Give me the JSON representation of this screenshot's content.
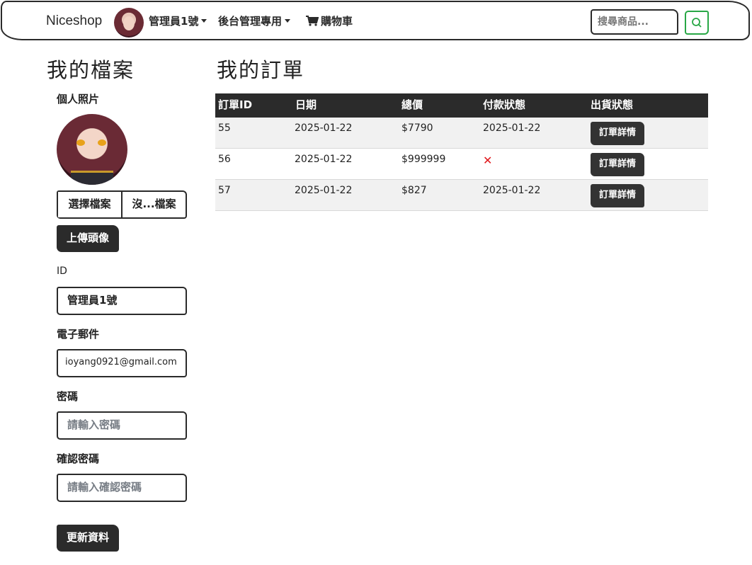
{
  "navbar": {
    "brand": "Niceshop",
    "user_menu": "管理員1號",
    "admin_menu": "後台管理專用",
    "cart": "購物車",
    "search_placeholder": "搜尋商品..."
  },
  "profile": {
    "title": "我的檔案",
    "photo_label": "個人照片",
    "choose_file": "選擇檔案",
    "file_name": "沒...檔案",
    "upload_button": "上傳頭像",
    "id_label": "ID",
    "id_value": "管理員1號",
    "email_label": "電子郵件",
    "email_value": "ioyang0921@gmail.com",
    "password_label": "密碼",
    "password_placeholder": "請輸入密碼",
    "confirm_label": "確認密碼",
    "confirm_placeholder": "請輸入確認密碼",
    "update_button": "更新資料"
  },
  "orders": {
    "title": "我的訂單",
    "headers": [
      "訂單ID",
      "日期",
      "總價",
      "付款狀態",
      "出貨狀態"
    ],
    "detail_label": "訂單詳情",
    "rows": [
      {
        "id": "55",
        "date": "2025-01-22",
        "total": "$7790",
        "payment": "2025-01-22",
        "paid": true
      },
      {
        "id": "56",
        "date": "2025-01-22",
        "total": "$999999",
        "payment": "✕",
        "paid": false
      },
      {
        "id": "57",
        "date": "2025-01-22",
        "total": "$827",
        "payment": "2025-01-22",
        "paid": true
      }
    ]
  },
  "colors": {
    "accent_green": "#28a745",
    "dark": "#2b2b2b",
    "unpaid_red": "#e0161a"
  }
}
